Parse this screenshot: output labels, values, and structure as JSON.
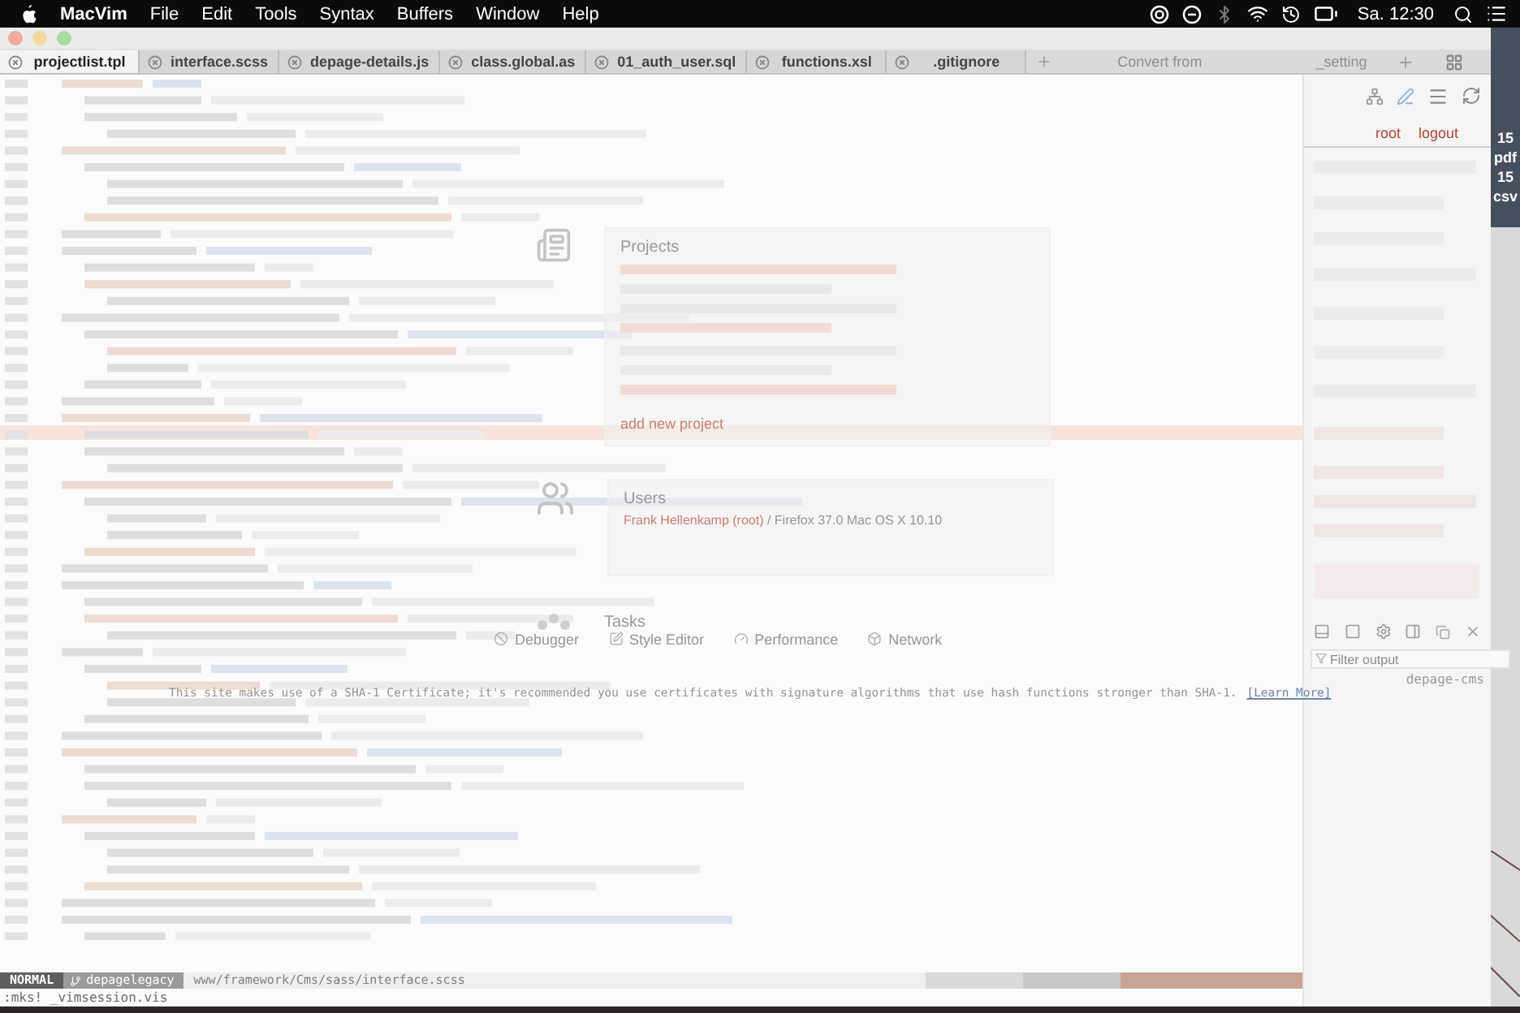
{
  "menu_bar": {
    "app": "MacVim",
    "menus": [
      "File",
      "Edit",
      "Tools",
      "Syntax",
      "Buffers",
      "Window",
      "Help"
    ],
    "clock": "Sa. 12:30"
  },
  "window": {
    "tabs": [
      {
        "label": "projectlist.tpl",
        "selected": true
      },
      {
        "label": "interface.scss",
        "selected": false
      },
      {
        "label": "depage-details.js",
        "selected": false
      },
      {
        "label": "class.global.as",
        "selected": false
      },
      {
        "label": "01_auth_user.sql",
        "selected": false
      },
      {
        "label": "functions.xsl",
        "selected": false
      },
      {
        "label": ".gitignore",
        "selected": false
      }
    ]
  },
  "browser_tabs": [
    "Convert from",
    "_setting"
  ],
  "page": {
    "account_links": [
      "root",
      "logout"
    ],
    "projects": {
      "title": "Projects",
      "add_link": "add new project"
    },
    "users": {
      "title": "Users",
      "user": "Frank Hellenkamp (root)",
      "agent": " / Firefox 37.0 Mac OS X 10.10"
    },
    "tasks": {
      "title": "Tasks"
    }
  },
  "devtools": {
    "tabs": [
      "Debugger",
      "Style Editor",
      "Performance",
      "Network"
    ],
    "filter": {
      "placeholder": "Filter output"
    },
    "console": {
      "message": "This site makes use of a SHA-1 Certificate; it's recommended you use certificates with signature algorithms that use hash functions stronger than SHA-1.",
      "link": "[Learn More]",
      "source": "depage-cms"
    }
  },
  "desktop_icons": [
    {
      "count": "15",
      "ext": "pdf"
    },
    {
      "count": "15",
      "ext": "csv"
    }
  ],
  "status_line": {
    "mode": "NORMAL",
    "branch": "depagelegacy",
    "path": "www/framework/Cms/sass/interface.scss"
  },
  "command_line": ":mks! _vimsession.vis"
}
